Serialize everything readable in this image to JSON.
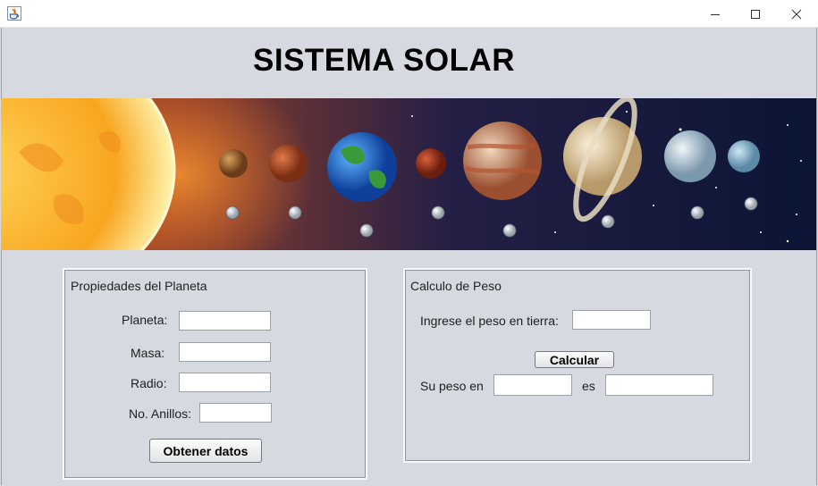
{
  "window": {
    "app_icon": "java-icon",
    "controls": [
      "minimize-icon",
      "maximize-icon",
      "close-icon"
    ]
  },
  "header": {
    "title": "SISTEMA SOLAR"
  },
  "banner": {
    "image": "solar-system-banner"
  },
  "propiedades": {
    "title": "Propiedades del Planeta",
    "planeta_label": "Planeta:",
    "planeta_value": "",
    "masa_label": "Masa:",
    "masa_value": "",
    "radio_label": "Radio:",
    "radio_value": "",
    "anillos_label": "No. Anillos:",
    "anillos_value": "",
    "button_label": "Obtener datos"
  },
  "peso": {
    "title": "Calculo de Peso",
    "ingrese_label": "Ingrese el peso en tierra:",
    "peso_value": "",
    "button_label": "Calcular",
    "su_peso_label": "Su peso en",
    "planeta_value": "",
    "es_label": "es",
    "resultado_value": ""
  },
  "colors": {
    "window_bg": "#d6d9df",
    "banner_space": "#0f1a3d",
    "sun": "#ffc640"
  }
}
